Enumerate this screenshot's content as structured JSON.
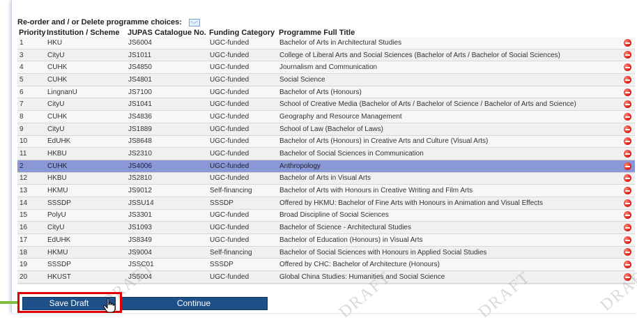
{
  "header": {
    "title": "Re-order and / or Delete programme choices:"
  },
  "table": {
    "columns": [
      "Priority",
      "Institution / Scheme",
      "JUPAS Catalogue No.",
      "Funding Category",
      "Programme Full Title"
    ],
    "rows": [
      {
        "priority": "1",
        "inst": "HKU",
        "code": "JS6004",
        "funding": "UGC-funded",
        "title": "Bachelor of Arts in Architectural Studies"
      },
      {
        "priority": "3",
        "inst": "CityU",
        "code": "JS1011",
        "funding": "UGC-funded",
        "title": "College of Liberal Arts and Social Sciences (Bachelor of Arts / Bachelor of Social Sciences)"
      },
      {
        "priority": "4",
        "inst": "CUHK",
        "code": "JS4850",
        "funding": "UGC-funded",
        "title": "Journalism and Communication"
      },
      {
        "priority": "5",
        "inst": "CUHK",
        "code": "JS4801",
        "funding": "UGC-funded",
        "title": "Social Science"
      },
      {
        "priority": "6",
        "inst": "LingnanU",
        "code": "JS7100",
        "funding": "UGC-funded",
        "title": "Bachelor of Arts (Honours)"
      },
      {
        "priority": "7",
        "inst": "CityU",
        "code": "JS1041",
        "funding": "UGC-funded",
        "title": "School of Creative Media (Bachelor of Arts / Bachelor of Science / Bachelor of Arts and Science)"
      },
      {
        "priority": "8",
        "inst": "CUHK",
        "code": "JS4836",
        "funding": "UGC-funded",
        "title": "Geography and Resource Management"
      },
      {
        "priority": "9",
        "inst": "CityU",
        "code": "JS1889",
        "funding": "UGC-funded",
        "title": "School of Law (Bachelor of Laws)"
      },
      {
        "priority": "10",
        "inst": "EdUHK",
        "code": "JS8648",
        "funding": "UGC-funded",
        "title": "Bachelor of Arts (Honours) in Creative Arts and Culture (Visual Arts)"
      },
      {
        "priority": "11",
        "inst": "HKBU",
        "code": "JS2310",
        "funding": "UGC-funded",
        "title": "Bachelor of Social Sciences in Communication"
      },
      {
        "priority": "2",
        "inst": "CUHK",
        "code": "JS4006",
        "funding": "UGC-funded",
        "title": "Anthropology",
        "selected": true
      },
      {
        "priority": "12",
        "inst": "HKBU",
        "code": "JS2810",
        "funding": "UGC-funded",
        "title": "Bachelor of Arts in Visual Arts"
      },
      {
        "priority": "13",
        "inst": "HKMU",
        "code": "JS9012",
        "funding": "Self-financing",
        "title": "Bachelor of Arts with Honours in Creative Writing and Film Arts"
      },
      {
        "priority": "14",
        "inst": "SSSDP",
        "code": "JSSU14",
        "funding": "SSSDP",
        "title": "Offered by HKMU: Bachelor of Fine Arts with Honours in Animation and Visual Effects"
      },
      {
        "priority": "15",
        "inst": "PolyU",
        "code": "JS3301",
        "funding": "UGC-funded",
        "title": "Broad Discipline of Social Sciences"
      },
      {
        "priority": "16",
        "inst": "CityU",
        "code": "JS1093",
        "funding": "UGC-funded",
        "title": "Bachelor of Science - Architectural Studies"
      },
      {
        "priority": "17",
        "inst": "EdUHK",
        "code": "JS8349",
        "funding": "UGC-funded",
        "title": "Bachelor of Education (Honours) in Visual Arts"
      },
      {
        "priority": "18",
        "inst": "HKMU",
        "code": "JS9004",
        "funding": "Self-financing",
        "title": "Bachelor of Social Sciences with Honours in Applied Social Studies"
      },
      {
        "priority": "19",
        "inst": "SSSDP",
        "code": "JSSC01",
        "funding": "SSSDP",
        "title": "Offered by CHC: Bachelor of Architecture (Honours)"
      },
      {
        "priority": "20",
        "inst": "HKUST",
        "code": "JS5004",
        "funding": "UGC-funded",
        "title": "Global China Studies: Humanities and Social Science"
      }
    ]
  },
  "buttons": {
    "save_draft": "Save Draft",
    "continue": "Continue"
  },
  "watermark": "DRAFT",
  "colors": {
    "selected_row": "#8b98d6",
    "button": "#1d4f88",
    "highlight": "#e00000",
    "delete_icon": "#e2231a"
  },
  "icons": {
    "delete": "minus-circle-icon",
    "header": "mail-icon",
    "cursor": "hand-pointer-icon"
  }
}
